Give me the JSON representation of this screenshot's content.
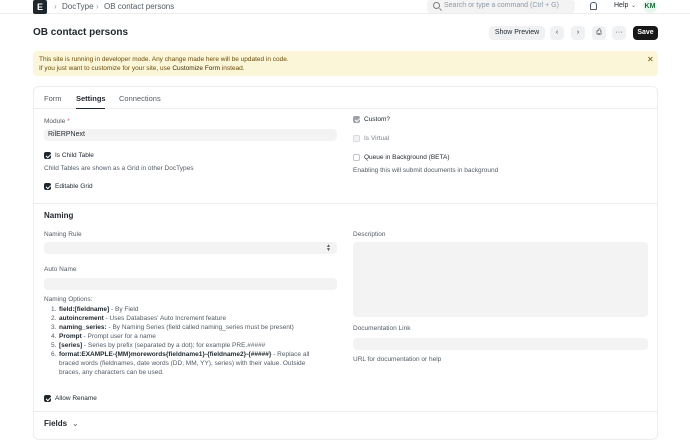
{
  "navbar": {
    "logo": "E",
    "breadcrumbs": [
      "DocType",
      "OB contact persons"
    ],
    "search_placeholder": "Search or type a command (Ctrl + G)",
    "help_label": "Help",
    "avatar_initials": "KM"
  },
  "page": {
    "title": "OB contact persons",
    "show_preview_label": "Show Preview",
    "save_label": "Save"
  },
  "alert": {
    "line1": "This site is running in developer mode. Any change made here will be updated in code.",
    "line2_prefix": "If you just want to customize for your site, use ",
    "line2_link": "Customize Form",
    "line2_suffix": " instead."
  },
  "tabs": [
    "Form",
    "Settings",
    "Connections"
  ],
  "settings": {
    "module_label": "Module",
    "module_value": "RilERPNext",
    "is_child_table_label": "Is Child Table",
    "is_child_table_hint": "Child Tables are shown as a Grid in other DocTypes",
    "editable_grid_label": "Editable Grid",
    "custom_label": "Custom?",
    "is_virtual_label": "Is Virtual",
    "queue_label": "Queue in Background (BETA)",
    "queue_hint": "Enabling this will submit documents in background"
  },
  "naming": {
    "section_title": "Naming",
    "naming_rule_label": "Naming Rule",
    "auto_name_label": "Auto Name",
    "options_title": "Naming Options:",
    "options": [
      {
        "num": "1.",
        "bold": "field:[fieldname]",
        "text": " - By Field"
      },
      {
        "num": "2.",
        "bold": "autoincrement",
        "text": " - Uses Databases' Auto Increment feature"
      },
      {
        "num": "3.",
        "bold": "naming_series:",
        "text": " - By Naming Series (field called naming_series must be present)"
      },
      {
        "num": "4.",
        "bold": "Prompt",
        "text": " - Prompt user for a name"
      },
      {
        "num": "5.",
        "bold": "[series]",
        "text": " - Series by prefix (separated by a dot); for example PRE.#####"
      },
      {
        "num": "6.",
        "bold": "format:EXAMPLE-{MM}morewords{fieldname1}-{fieldname2}-{#####}",
        "text": " - Replace all"
      }
    ],
    "option6_line2": "braced words (fieldnames, date words (DD, MM, YY), series) with their value. Outside",
    "option6_line3": "braces, any characters can be used.",
    "allow_rename_label": "Allow Rename",
    "description_label": "Description",
    "doc_link_label": "Documentation Link",
    "doc_link_hint": "URL for documentation or help"
  },
  "fields_section": {
    "title": "Fields"
  }
}
